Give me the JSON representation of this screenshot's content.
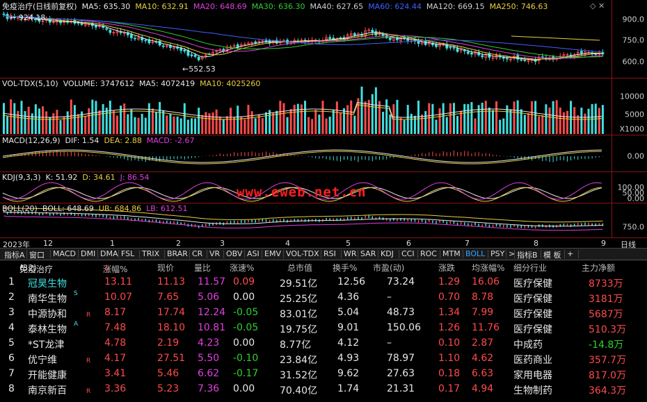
{
  "colors": {
    "up": "#ff4a4a",
    "down": "#40e0e0",
    "grid": "#8a1414",
    "ma5": "#e8e8e8",
    "ma10": "#e8d040",
    "ma20": "#e040e0",
    "ma30": "#30d030",
    "ma40": "#d0d0d0",
    "ma60": "#4060ff",
    "ma120": "#d0d0d0",
    "ma250": "#e8d040"
  },
  "main": {
    "title": "免疫治疗(日线前复权)",
    "items": [
      {
        "label": "MA5: 635.30",
        "color": "#e8e8e8"
      },
      {
        "label": "MA10: 632.91",
        "color": "#e8d040"
      },
      {
        "label": "MA20: 648.69",
        "color": "#e040e0"
      },
      {
        "label": "MA30: 636.30",
        "color": "#30d030"
      },
      {
        "label": "MA40: 627.65",
        "color": "#d0d0d0"
      },
      {
        "label": "MA60: 624.44",
        "color": "#4060ff"
      },
      {
        "label": "MA120: 669.15",
        "color": "#d0d0d0"
      },
      {
        "label": "MA250: 746.63",
        "color": "#e8d040"
      }
    ],
    "high_label": "924.18",
    "low_label": "552.53",
    "ticks": [
      "900.0",
      "750.0",
      "600.0"
    ]
  },
  "vol": {
    "title": "VOL-TDX(5,10)",
    "items": [
      {
        "label": "VOLUME: 3747612",
        "color": "#e8e8e8"
      },
      {
        "label": "MA5: 4072419",
        "color": "#e8e8e8"
      },
      {
        "label": "MA10: 4025260",
        "color": "#e8d040"
      }
    ],
    "ticks": [
      "10000",
      "5000",
      "X1000"
    ]
  },
  "macd": {
    "title": "MACD(12,26,9)",
    "items": [
      {
        "label": "DIF: 1.54",
        "color": "#e8e8e8"
      },
      {
        "label": "DEA: 2.88",
        "color": "#e8d040"
      },
      {
        "label": "MACD: -2.67",
        "color": "#e040e0"
      }
    ],
    "ticks": [
      "0.00"
    ]
  },
  "kdj": {
    "title": "KDJ(9,3,3)",
    "items": [
      {
        "label": "K: 51.92",
        "color": "#e8e8e8"
      },
      {
        "label": "D: 34.61",
        "color": "#e8d040"
      },
      {
        "label": "J: 86.54",
        "color": "#e040e0"
      }
    ],
    "ticks": [
      "100.00",
      "50.00",
      "0.00"
    ],
    "watermark": "www.eweb.net.cn"
  },
  "boll": {
    "title": "BOLL(20)",
    "items": [
      {
        "label": "BOLL: 648.69",
        "color": "#e8e8e8"
      },
      {
        "label": "UB: 684.86",
        "color": "#e8d040"
      },
      {
        "label": "LB: 612.51",
        "color": "#e040e0"
      }
    ],
    "ticks": [
      "750.0"
    ]
  },
  "timeaxis": {
    "labels": [
      "2023年",
      "12",
      "1",
      "2",
      "3",
      "4",
      "5",
      "6",
      "7",
      "8",
      "9"
    ],
    "right_label": "日线"
  },
  "tabs": [
    "指标A",
    "窗口",
    "MACD",
    "DMI",
    "DMA",
    "FSL",
    "TRIX",
    "BRAR",
    "CR",
    "VR",
    "OBV",
    "ASI",
    "EMV",
    "VOL-TDX",
    "RSI",
    "WR",
    "SAR",
    "KDJ",
    "CCI",
    "ROC",
    "MTM",
    "BOLL",
    "PSY",
    ">",
    "指标B",
    "模 板",
    "+"
  ],
  "active_tab": "BOLL",
  "table": {
    "block": "免疫治疗",
    "count": "(32)",
    "headers": [
      "涨幅%",
      "现价",
      "量比",
      "涨速%",
      "总市值",
      "换手%",
      "市盈(动)",
      "涨跌",
      "均涨幅%",
      "细分行业",
      "主力净额"
    ],
    "rows": [
      {
        "n": "1",
        "name": "冠昊生物",
        "flag": "",
        "chg": "13.11",
        "price": "11.13",
        "vr": "11.57",
        "spd": "0.09",
        "cap": "29.51亿",
        "turn": "12.56",
        "pe": "73.24",
        "diff": "1.29",
        "avg": "16.06",
        "ind": "医疗保健",
        "net": "8733万"
      },
      {
        "n": "2",
        "name": "南华生物",
        "flag": "S",
        "chg": "10.07",
        "price": "7.65",
        "vr": "5.06",
        "spd": "0.00",
        "cap": "25.25亿",
        "turn": "4.36",
        "pe": "–",
        "diff": "0.70",
        "avg": "8.78",
        "ind": "医疗保健",
        "net": "3181万"
      },
      {
        "n": "3",
        "name": "中源协和",
        "flag": "R",
        "chg": "8.17",
        "price": "17.74",
        "vr": "12.24",
        "spd": "-0.05",
        "cap": "83.01亿",
        "turn": "5.04",
        "pe": "48.73",
        "diff": "1.34",
        "avg": "7.99",
        "ind": "医疗保健",
        "net": "5687万"
      },
      {
        "n": "4",
        "name": "泰林生物",
        "flag": "A",
        "chg": "7.48",
        "price": "18.10",
        "vr": "10.81",
        "spd": "-0.05",
        "cap": "19.75亿",
        "turn": "9.01",
        "pe": "150.06",
        "diff": "1.26",
        "avg": "11.76",
        "ind": "医疗保健",
        "net": "510.3万"
      },
      {
        "n": "5",
        "name": "*ST龙津",
        "flag": "",
        "chg": "4.78",
        "price": "2.19",
        "vr": "4.23",
        "spd": "0.00",
        "cap": "8.77亿",
        "turn": "4.12",
        "pe": "–",
        "diff": "0.10",
        "avg": "2.87",
        "ind": "中成药",
        "net": "-14.8万"
      },
      {
        "n": "6",
        "name": "优宁维",
        "flag": "R",
        "chg": "4.17",
        "price": "27.51",
        "vr": "5.50",
        "spd": "-0.10",
        "cap": "23.84亿",
        "turn": "4.93",
        "pe": "78.97",
        "diff": "1.10",
        "avg": "4.62",
        "ind": "医药商业",
        "net": "357.7万"
      },
      {
        "n": "7",
        "name": "开能健康",
        "flag": "",
        "chg": "3.41",
        "price": "5.46",
        "vr": "6.62",
        "spd": "-0.17",
        "cap": "31.52亿",
        "turn": "9.62",
        "pe": "27.63",
        "diff": "0.18",
        "avg": "6.63",
        "ind": "家用电器",
        "net": "817.0万"
      },
      {
        "n": "8",
        "name": "南京新百",
        "flag": "R",
        "chg": "3.36",
        "price": "5.23",
        "vr": "7.36",
        "spd": "0.00",
        "cap": "70.40亿",
        "turn": "1.74",
        "pe": "21.31",
        "diff": "0.17",
        "avg": "4.94",
        "ind": "生物制药",
        "net": "364.3万"
      }
    ]
  }
}
